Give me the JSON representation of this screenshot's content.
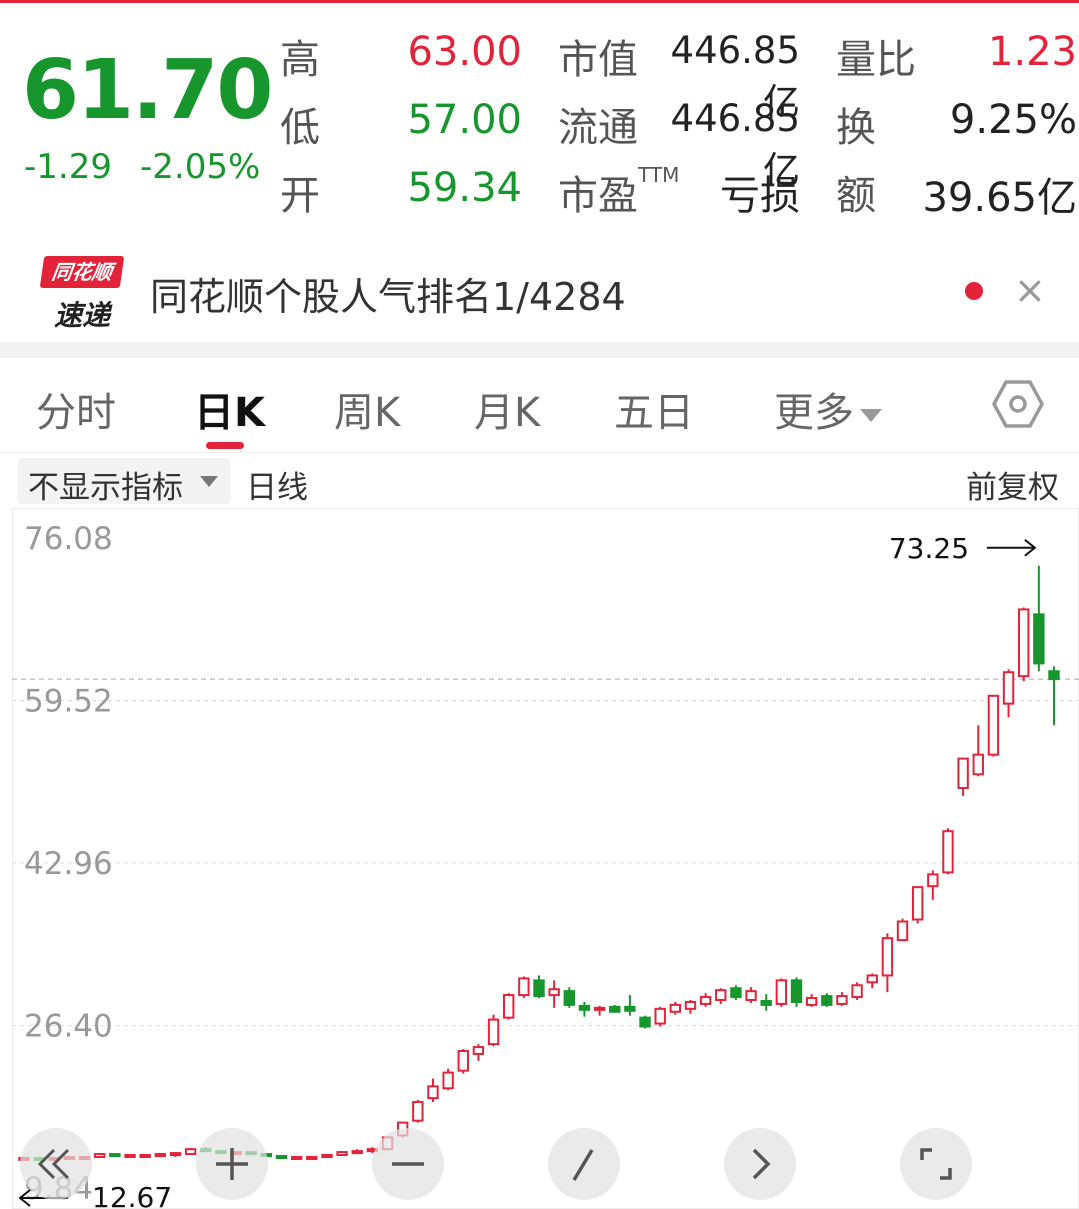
{
  "quote": {
    "price": "61.70",
    "change": "-1.29",
    "change_pct": "-2.05%",
    "high_label": "高",
    "high": "63.00",
    "low_label": "低",
    "low": "57.00",
    "open_label": "开",
    "open": "59.34",
    "mcap_label": "市值",
    "mcap": "446.85亿",
    "float_label": "流通",
    "float": "446.85亿",
    "pe_label": "市盈",
    "pe_sup": "TTM",
    "pe": "亏损",
    "vol_ratio_label": "量比",
    "vol_ratio": "1.23",
    "turnover_label": "换",
    "turnover": "9.25%",
    "amount_label": "额",
    "amount": "39.65亿"
  },
  "banner": {
    "logo_top": "同花顺",
    "logo_bottom": "速递",
    "text": "同花顺个股人气排名1/4284",
    "close": "×"
  },
  "tabs": [
    "分时",
    "日K",
    "周K",
    "月K",
    "五日",
    "更多"
  ],
  "active_tab": "日K",
  "indicator": {
    "selector": "不显示指标",
    "period": "日线",
    "adjust": "前复权"
  },
  "icons": {
    "settings": "settings-hexagon-icon",
    "buttons": [
      "double-left-chevron-icon",
      "zoom-in-plus-icon",
      "zoom-out-minus-icon",
      "draw-line-icon",
      "right-chevron-icon",
      "fullscreen-icon"
    ]
  },
  "colors": {
    "up": "#e2233a",
    "down": "#17962e",
    "grid": "#dddddd"
  },
  "chart_data": {
    "type": "candlestick",
    "y_ticks": [
      "76.08",
      "59.52",
      "42.96",
      "26.40",
      "9.84"
    ],
    "ylim": [
      9.84,
      76.08
    ],
    "ref_line": 61.7,
    "max_annotation": "73.25",
    "min_annotation": "12.67",
    "candles": [
      [
        12.8,
        12.9,
        12.7,
        12.9
      ],
      [
        12.9,
        12.9,
        12.8,
        12.8
      ],
      [
        12.8,
        13.0,
        12.7,
        12.9
      ],
      [
        12.9,
        13.0,
        12.8,
        13.0
      ],
      [
        13.0,
        13.1,
        12.9,
        13.0
      ],
      [
        13.0,
        13.4,
        12.9,
        13.3
      ],
      [
        13.3,
        13.3,
        13.0,
        13.1
      ],
      [
        13.1,
        13.3,
        13.0,
        13.2
      ],
      [
        13.2,
        13.3,
        13.1,
        13.2
      ],
      [
        13.2,
        13.3,
        13.1,
        13.3
      ],
      [
        13.2,
        13.5,
        13.0,
        13.4
      ],
      [
        13.3,
        13.9,
        13.2,
        13.8
      ],
      [
        13.8,
        14.0,
        13.5,
        13.6
      ],
      [
        13.6,
        13.7,
        13.3,
        13.4
      ],
      [
        13.4,
        13.5,
        13.3,
        13.5
      ],
      [
        13.5,
        13.5,
        13.2,
        13.3
      ],
      [
        13.3,
        13.4,
        13.0,
        13.1
      ],
      [
        13.1,
        13.2,
        12.9,
        13.0
      ],
      [
        13.0,
        13.1,
        12.9,
        13.0
      ],
      [
        13.0,
        13.1,
        12.9,
        13.0
      ],
      [
        13.0,
        13.3,
        12.9,
        13.2
      ],
      [
        13.2,
        13.6,
        13.1,
        13.5
      ],
      [
        13.5,
        13.8,
        13.3,
        13.6
      ],
      [
        13.6,
        14.0,
        13.4,
        13.8
      ],
      [
        13.8,
        15.1,
        13.7,
        15.0
      ],
      [
        15.2,
        16.6,
        15.0,
        16.5
      ],
      [
        16.7,
        18.8,
        16.5,
        18.6
      ],
      [
        19.0,
        21.0,
        18.6,
        20.2
      ],
      [
        20.0,
        22.0,
        19.8,
        21.6
      ],
      [
        21.8,
        24.0,
        21.5,
        23.8
      ],
      [
        23.5,
        24.5,
        22.8,
        24.2
      ],
      [
        24.5,
        27.5,
        24.3,
        27.0
      ],
      [
        27.2,
        29.7,
        27.0,
        29.5
      ],
      [
        29.5,
        31.4,
        29.2,
        31.2
      ],
      [
        31.0,
        31.5,
        29.2,
        29.4
      ],
      [
        29.5,
        31.0,
        28.2,
        30.1
      ],
      [
        29.9,
        30.3,
        28.2,
        28.5
      ],
      [
        28.4,
        28.8,
        27.3,
        28.0
      ],
      [
        28.0,
        28.4,
        27.4,
        28.2
      ],
      [
        28.3,
        28.5,
        27.7,
        27.8
      ],
      [
        28.3,
        29.5,
        27.4,
        27.9
      ],
      [
        27.2,
        27.4,
        26.1,
        26.3
      ],
      [
        26.6,
        28.3,
        26.3,
        28.1
      ],
      [
        27.8,
        28.8,
        27.5,
        28.5
      ],
      [
        28.1,
        29.0,
        27.6,
        28.8
      ],
      [
        28.6,
        29.7,
        28.3,
        29.3
      ],
      [
        29.0,
        30.2,
        28.6,
        30.0
      ],
      [
        30.2,
        30.5,
        29.0,
        29.3
      ],
      [
        29.0,
        30.3,
        28.7,
        29.9
      ],
      [
        28.9,
        29.6,
        27.9,
        28.5
      ],
      [
        28.6,
        31.2,
        28.3,
        31.0
      ],
      [
        31.0,
        31.3,
        28.3,
        28.8
      ],
      [
        28.5,
        29.6,
        28.3,
        29.2
      ],
      [
        29.4,
        29.7,
        28.3,
        28.5
      ],
      [
        28.6,
        29.8,
        28.4,
        29.4
      ],
      [
        29.3,
        30.8,
        29.0,
        30.5
      ],
      [
        30.8,
        31.7,
        30.2,
        31.5
      ],
      [
        31.5,
        35.8,
        29.8,
        35.3
      ],
      [
        35.1,
        37.3,
        35.0,
        37.0
      ],
      [
        37.2,
        40.0,
        36.8,
        40.5
      ],
      [
        40.6,
        42.2,
        39.2,
        41.8
      ],
      [
        42.0,
        46.5,
        41.8,
        46.2
      ],
      [
        50.6,
        53.5,
        49.8,
        53.6
      ],
      [
        52.0,
        57.0,
        51.8,
        54.0
      ],
      [
        54.0,
        59.8,
        53.8,
        60.0
      ],
      [
        59.2,
        62.7,
        57.8,
        62.4
      ],
      [
        62.0,
        69.0,
        61.5,
        68.8
      ],
      [
        68.3,
        73.25,
        62.5,
        63.3
      ],
      [
        62.5,
        63.0,
        57.0,
        61.7
      ]
    ]
  }
}
